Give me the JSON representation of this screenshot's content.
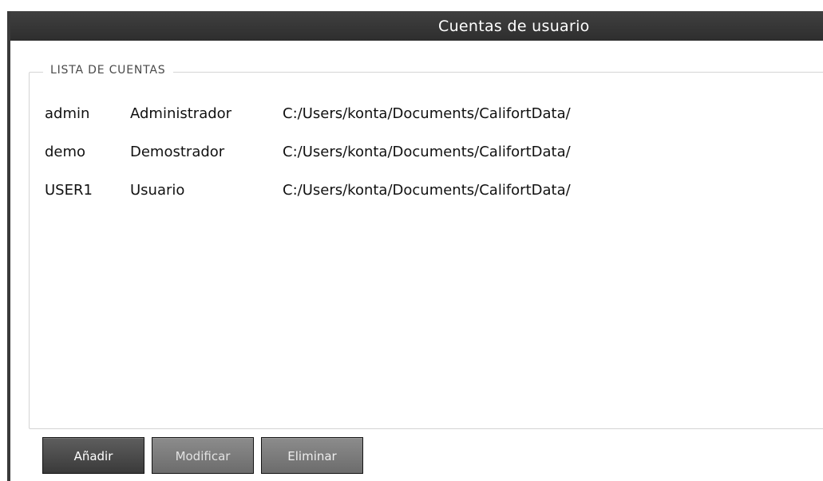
{
  "window": {
    "title": "Cuentas de usuario"
  },
  "accounts_group": {
    "legend": "LISTA DE CUENTAS",
    "rows": [
      {
        "user": "admin",
        "role": "Administrador",
        "path": "C:/Users/konta/Documents/CalifortData/"
      },
      {
        "user": "demo",
        "role": "Demostrador",
        "path": "C:/Users/konta/Documents/CalifortData/"
      },
      {
        "user": "USER1",
        "role": "Usuario",
        "path": "C:/Users/konta/Documents/CalifortData/"
      }
    ]
  },
  "buttons": {
    "add_label": "Añadir",
    "modify_label": "Modificar",
    "delete_label": "Eliminar"
  },
  "colors": {
    "titlebar": "#363636",
    "primary_button": "#4a4a4a",
    "disabled_button": "#7c7c7c",
    "group_border": "#d4d4d4"
  }
}
